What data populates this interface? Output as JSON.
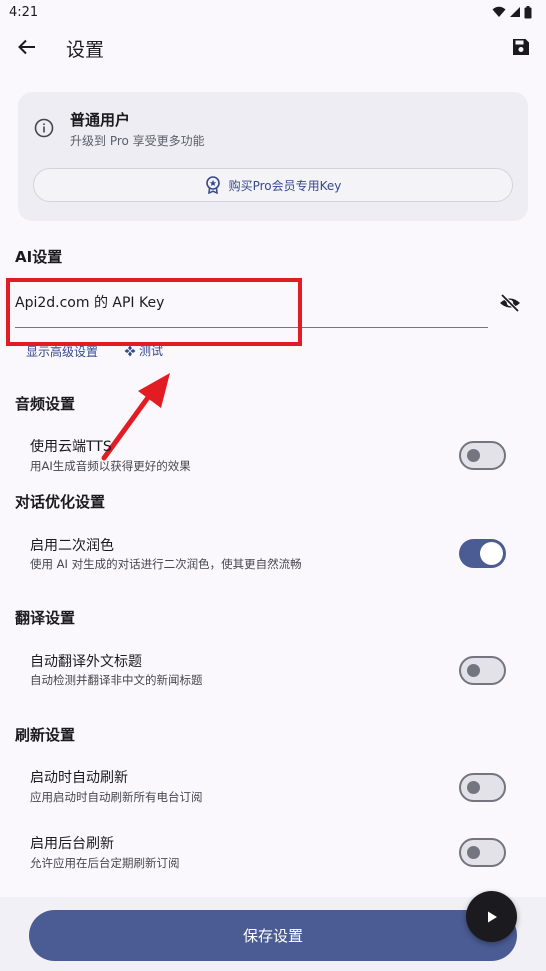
{
  "status_bar": {
    "time": "4:21"
  },
  "header": {
    "title": "设置"
  },
  "user_card": {
    "title": "普通用户",
    "subtitle": "升级到 Pro 享受更多功能",
    "buy_label": "购买Pro会员专用Key"
  },
  "ai_section": {
    "title": "AI设置",
    "api_key_label": "Api2d.com 的 API Key",
    "advanced_link": "显示高级设置",
    "test_link": "测试"
  },
  "audio_section": {
    "title": "音频设置",
    "items": [
      {
        "title": "使用云端TTS",
        "subtitle": "用AI生成音频以获得更好的效果",
        "enabled": false
      }
    ]
  },
  "dialog_section": {
    "title": "对话优化设置",
    "items": [
      {
        "title": "启用二次润色",
        "subtitle": "使用 AI 对生成的对话进行二次润色，使其更自然流畅",
        "enabled": true
      }
    ]
  },
  "translate_section": {
    "title": "翻译设置",
    "items": [
      {
        "title": "自动翻译外文标题",
        "subtitle": "自动检测并翻译非中文的新闻标题",
        "enabled": false
      }
    ]
  },
  "refresh_section": {
    "title": "刷新设置",
    "items": [
      {
        "title": "启动时自动刷新",
        "subtitle": "应用启动时自动刷新所有电台订阅",
        "enabled": false
      },
      {
        "title": "启用后台刷新",
        "subtitle": "允许应用在后台定期刷新订阅",
        "enabled": false
      }
    ]
  },
  "footer": {
    "save_label": "保存设置"
  },
  "colors": {
    "primary": "#4a5c93",
    "annotation_red": "#e31b23",
    "background": "#fbf8fd"
  }
}
